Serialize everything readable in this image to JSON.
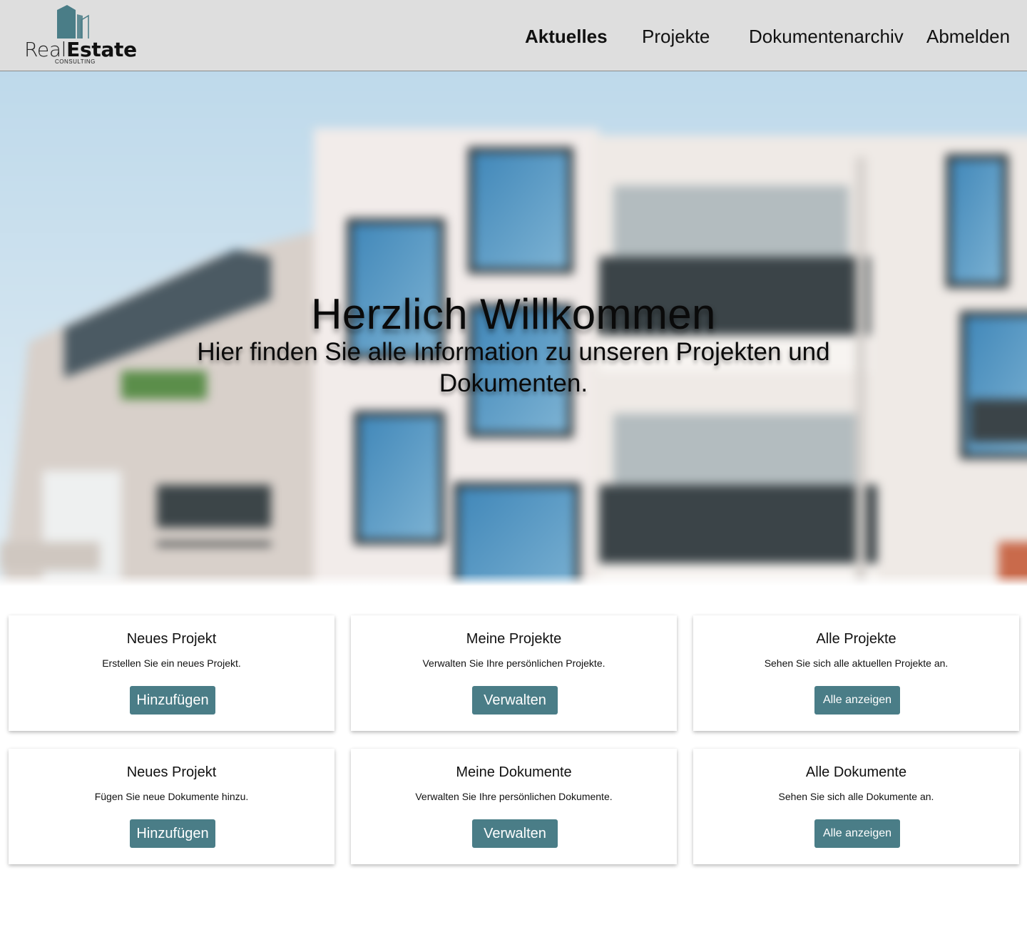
{
  "logo": {
    "brand_light": "Real",
    "brand_bold": "Estate",
    "tagline": "CONSULTING",
    "color": "#4a7d87"
  },
  "nav": {
    "items": [
      {
        "label": "Aktuelles",
        "active": true
      },
      {
        "label": "Projekte",
        "active": false
      },
      {
        "label": "Dokumentenarchiv",
        "active": false
      },
      {
        "label": "Abmelden",
        "active": false
      }
    ]
  },
  "hero": {
    "title": "Herzlich Willkommen",
    "subtitle": "Hier finden Sie alle Information zu unseren Projekten und Dokumenten."
  },
  "cards": [
    {
      "title": "Neues Projekt",
      "description": "Erstellen Sie ein neues Projekt.",
      "button": "Hinzufügen"
    },
    {
      "title": "Meine Projekte",
      "description": "Verwalten Sie Ihre persönlichen Projekte.",
      "button": "Verwalten"
    },
    {
      "title": "Alle Projekte",
      "description": "Sehen Sie sich alle aktuellen Projekte an.",
      "button": "Alle anzeigen"
    },
    {
      "title": "Neues Projekt",
      "description": "Fügen Sie neue Dokumente hinzu.",
      "button": "Hinzufügen"
    },
    {
      "title": "Meine Dokumente",
      "description": "Verwalten Sie Ihre persönlichen Dokumente.",
      "button": "Verwalten"
    },
    {
      "title": "Alle Dokumente",
      "description": "Sehen Sie sich alle Dokumente an.",
      "button": "Alle anzeigen"
    }
  ],
  "colors": {
    "header_bg": "#dedede",
    "button_bg": "#4a7d87",
    "button_text": "#ffffff"
  }
}
